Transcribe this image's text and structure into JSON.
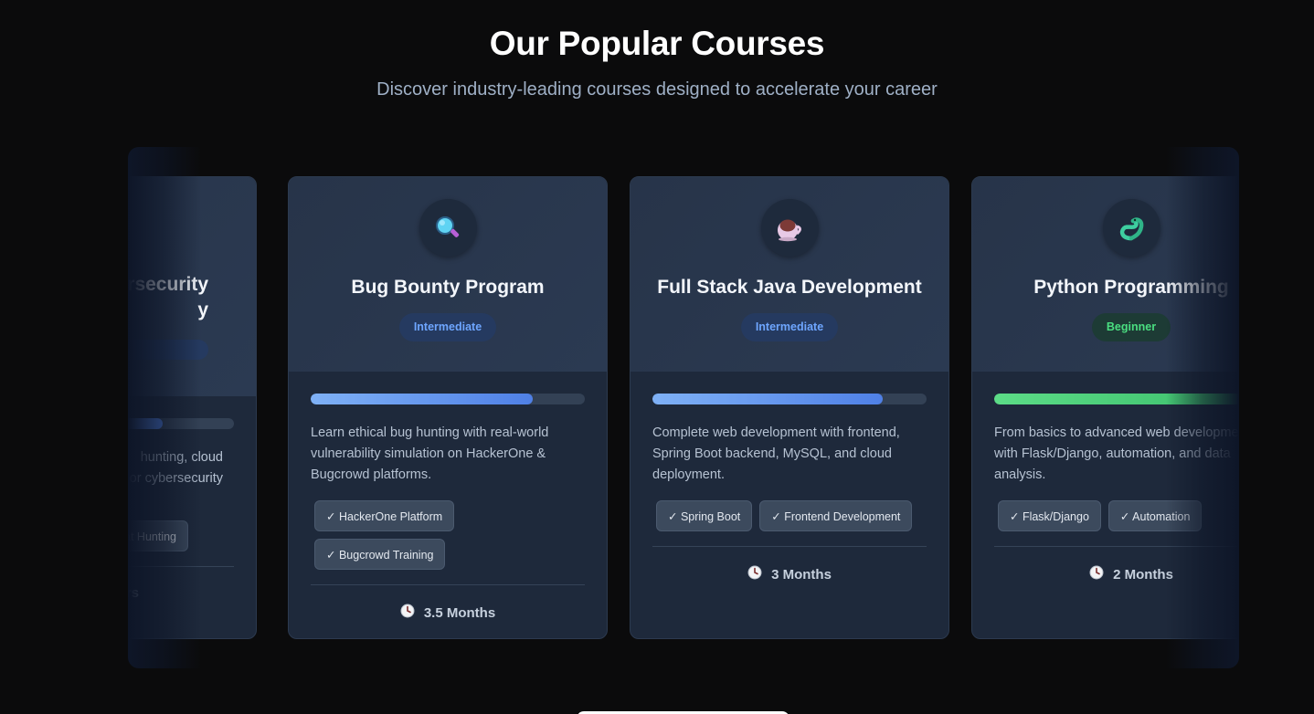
{
  "section": {
    "title": "Our Popular Courses",
    "subtitle": "Discover industry-leading courses designed to accelerate your career"
  },
  "courses": [
    {
      "title": "…rsecurity …y",
      "title_line1": "rsecurity",
      "title_line2": "y",
      "level": "",
      "progress": 0.45,
      "description": "…hunting, cloud …or cybersecurity",
      "desc_line1": "hunting, cloud",
      "desc_line2": "or cybersecurity",
      "tags": [
        "at Hunting"
      ],
      "duration": "rs",
      "accent": "#4f80e6"
    },
    {
      "icon": "magnifying-glass-icon",
      "title": "Bug Bounty Program",
      "level": "Intermediate",
      "progress": 0.81,
      "description": "Learn ethical bug hunting with real-world vulnerability simulation on HackerOne & Bugcrowd platforms.",
      "tags": [
        "✓ HackerOne Platform",
        "✓ Bugcrowd Training"
      ],
      "duration": "3.5 Months",
      "accent": "#4f80e6"
    },
    {
      "icon": "coffee-cup-icon",
      "title": "Full Stack Java Development",
      "level": "Intermediate",
      "progress": 0.84,
      "description": "Complete web development with frontend, Spring Boot backend, MySQL, and cloud deployment.",
      "tags": [
        "✓ Spring Boot",
        "✓ Frontend Development"
      ],
      "duration": "3 Months",
      "accent": "#4f80e6"
    },
    {
      "icon": "python-snake-icon",
      "title": "Python Programming",
      "level": "Beginner",
      "progress": 0.9,
      "description": "From basics to advanced web development with Flask/Django, automation, and data analysis.",
      "tags": [
        "✓ Flask/Django",
        "✓ Automation"
      ],
      "duration": "2 Months",
      "accent": "#4ade80"
    }
  ]
}
